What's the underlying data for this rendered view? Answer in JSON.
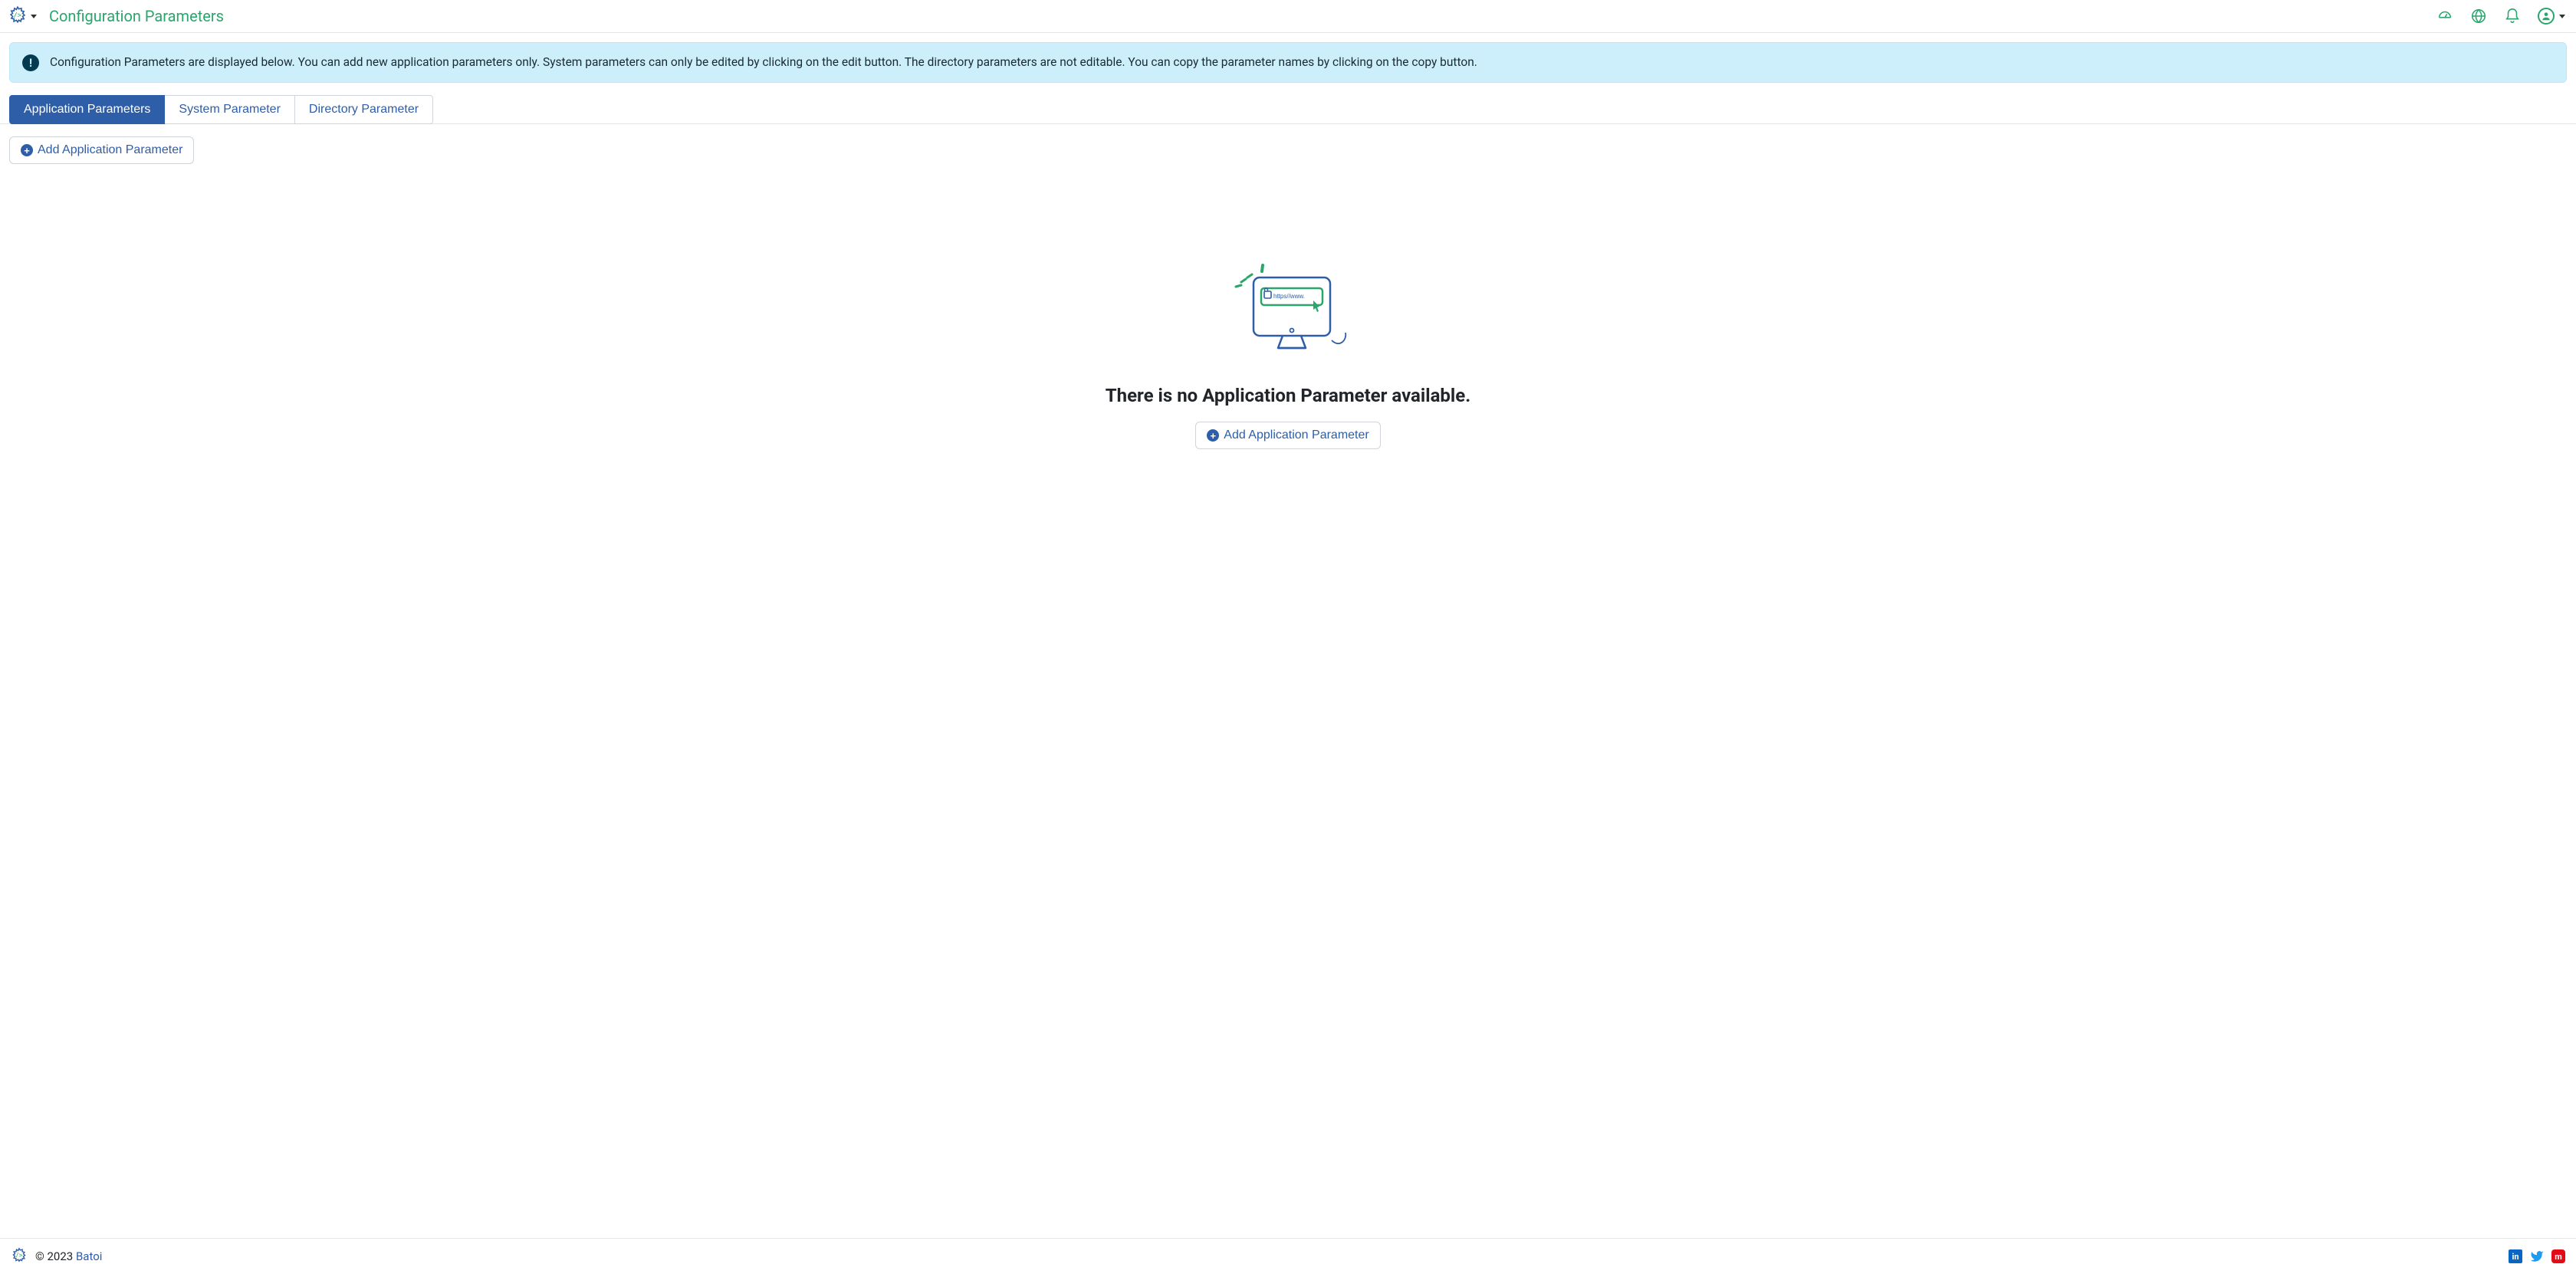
{
  "header": {
    "page_title": "Configuration Parameters"
  },
  "banner": {
    "text": "Configuration Parameters are displayed below. You can add new application parameters only. System parameters can only be edited by clicking on the edit button. The directory parameters are not editable. You can copy the parameter names by clicking on the copy button."
  },
  "tabs": {
    "application": "Application Parameters",
    "system": "System Parameter",
    "directory": "Directory Parameter",
    "active": "application"
  },
  "buttons": {
    "add_application_parameter": "Add Application Parameter"
  },
  "empty_state": {
    "heading": "There is no Application Parameter available.",
    "url_text": "https//www."
  },
  "footer": {
    "copyright_prefix": "© 2023 ",
    "brand": "Batoi"
  }
}
